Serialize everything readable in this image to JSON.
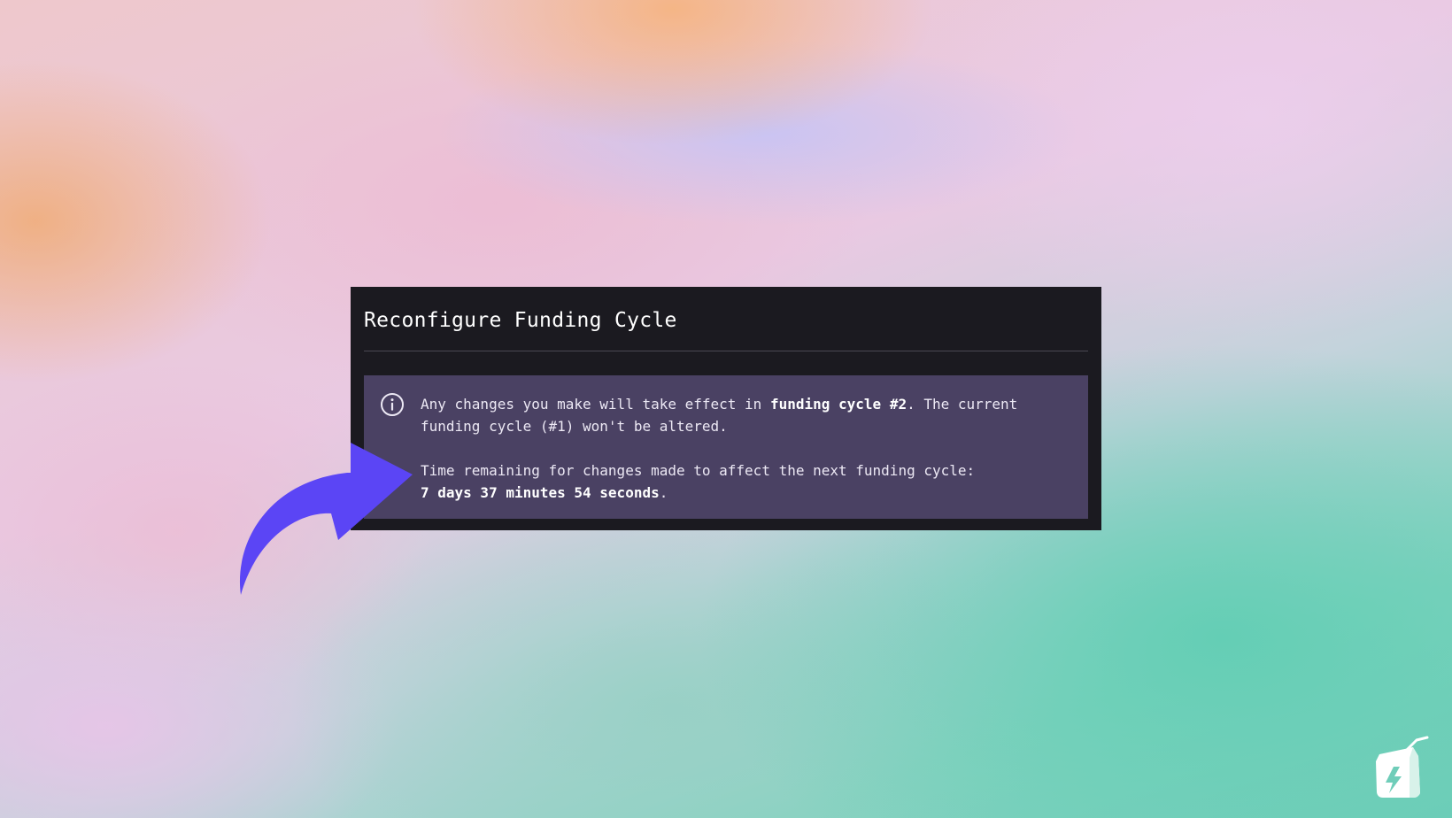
{
  "dialog": {
    "title": "Reconfigure Funding Cycle",
    "notice": {
      "icon": "info-icon",
      "line1_pre": "Any changes you make will take effect in ",
      "line1_bold": "funding cycle #2",
      "line1_post": ". The current funding cycle (#1) won't be altered.",
      "line2_text": "Time remaining for changes made to affect the next funding cycle:",
      "line2_bold": "7 days 37 minutes 54 seconds",
      "line2_post": "."
    }
  },
  "decorations": {
    "arrow_color": "#5b45f5",
    "logo_icon": "juicebox-logo-icon"
  }
}
